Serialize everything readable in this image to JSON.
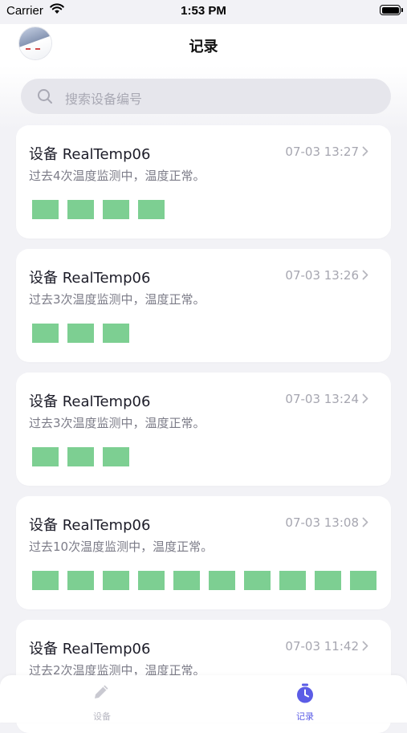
{
  "status_bar": {
    "carrier": "Carrier",
    "time": "1:53 PM"
  },
  "header": {
    "title": "记录"
  },
  "search": {
    "placeholder": "搜索设备编号"
  },
  "colors": {
    "healthy_block": "#7dcf92",
    "accent": "#5b5ce6"
  },
  "records": [
    {
      "title": "设备 RealTemp06",
      "time": "07-03 13:27",
      "summary": "过去4次温度监测中，温度正常。",
      "readings": 4,
      "status": "normal"
    },
    {
      "title": "设备 RealTemp06",
      "time": "07-03 13:26",
      "summary": "过去3次温度监测中，温度正常。",
      "readings": 3,
      "status": "normal"
    },
    {
      "title": "设备 RealTemp06",
      "time": "07-03 13:24",
      "summary": "过去3次温度监测中，温度正常。",
      "readings": 3,
      "status": "normal"
    },
    {
      "title": "设备 RealTemp06",
      "time": "07-03 13:08",
      "summary": "过去10次温度监测中，温度正常。",
      "readings": 10,
      "status": "normal"
    },
    {
      "title": "设备 RealTemp06",
      "time": "07-03 11:42",
      "summary": "过去2次温度监测中，温度正常。",
      "readings": 2,
      "status": "normal"
    }
  ],
  "tabbar": {
    "items": [
      {
        "label": "设备",
        "icon": "pencil-icon",
        "active": false
      },
      {
        "label": "记录",
        "icon": "timer-icon",
        "active": true
      }
    ]
  }
}
